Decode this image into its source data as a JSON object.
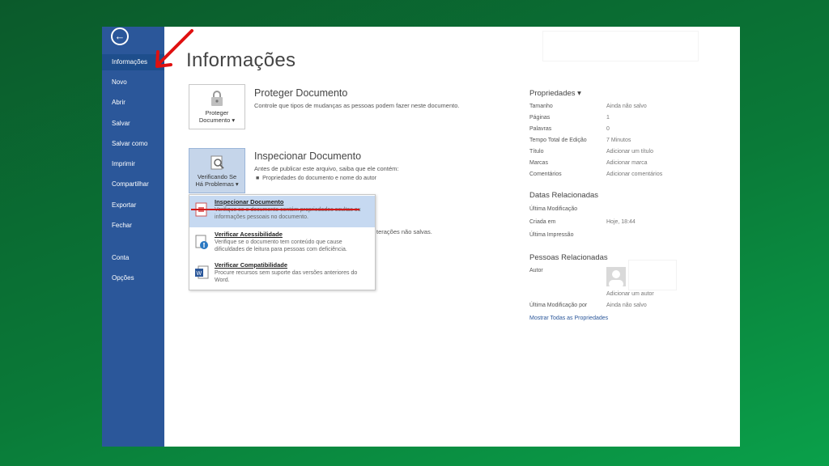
{
  "sidebar": {
    "back_icon": "back-arrow-icon",
    "items": [
      {
        "label": "Informações",
        "active": true
      },
      {
        "label": "Novo"
      },
      {
        "label": "Abrir"
      },
      {
        "label": "Salvar"
      },
      {
        "label": "Salvar como"
      },
      {
        "label": "Imprimir"
      },
      {
        "label": "Compartilhar"
      },
      {
        "label": "Exportar"
      },
      {
        "label": "Fechar"
      },
      {
        "label": "Conta"
      },
      {
        "label": "Opções"
      }
    ]
  },
  "main": {
    "title": "Informações",
    "protect": {
      "button_label_1": "Proteger",
      "button_label_2": "Documento ▾",
      "title": "Proteger Documento",
      "description": "Controle que tipos de mudanças as pessoas podem fazer neste documento."
    },
    "inspect": {
      "button_label_1": "Verificando Se",
      "button_label_2": "Há Problemas ▾",
      "title": "Inspecionar Documento",
      "description": "Antes de publicar este arquivo, saiba que ele contém:",
      "bullet": "Propriedades do documento e nome do autor"
    },
    "hidden_text": "terações não salvas.",
    "dropdown": [
      {
        "title": "Inspecionar Documento",
        "desc": "Verifique se o documento contém propriedades ocultas ou informações pessoais no documento."
      },
      {
        "title": "Verificar Acessibilidade",
        "desc": "Verifique se o documento tem conteúdo que cause dificuldades de leitura para pessoas com deficiência."
      },
      {
        "title": "Verificar Compatibilidade",
        "desc": "Procure recursos sem suporte das versões anteriores do Word."
      }
    ]
  },
  "properties": {
    "header": "Propriedades ▾",
    "rows": [
      {
        "key": "Tamanho",
        "value": "Ainda não salvo"
      },
      {
        "key": "Páginas",
        "value": "1"
      },
      {
        "key": "Palavras",
        "value": "0"
      },
      {
        "key": "Tempo Total de Edição",
        "value": "7 Minutos"
      },
      {
        "key": "Título",
        "value": "Adicionar um título"
      },
      {
        "key": "Marcas",
        "value": "Adicionar marca"
      },
      {
        "key": "Comentários",
        "value": "Adicionar comentários"
      }
    ],
    "dates_header": "Datas Relacionadas",
    "dates": [
      {
        "key": "Última Modificação",
        "value": ""
      },
      {
        "key": "Criada em",
        "value": "Hoje, 18:44"
      },
      {
        "key": "Última Impressão",
        "value": ""
      }
    ],
    "people_header": "Pessoas Relacionadas",
    "author_key": "Autor",
    "add_author": "Adicionar um autor",
    "last_modified_by_key": "Última Modificação por",
    "last_modified_by_value": "Ainda não salvo",
    "show_all": "Mostrar Todas as Propriedades"
  },
  "colors": {
    "sidebar": "#2b579a",
    "annotation": "#d11a1a",
    "background_green": "#0a7a38"
  }
}
